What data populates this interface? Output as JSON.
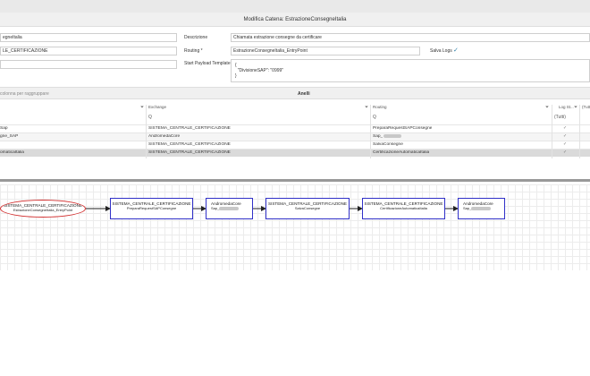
{
  "header": {
    "title": "Modifica Catena: EstrazioneConsegneItalia"
  },
  "form": {
    "name_value": "egneItalia",
    "system_value": "LE_CERTIFICAZIONE",
    "descrizione_label": "Descrizione",
    "descrizione_value": "Chiamata estrazione consegne da certificare",
    "routing_label": "Routing *",
    "routing_value": "EstrazioneConsegneItalia_EntryPoint",
    "salva_log_label": "Salva Logs",
    "payload_label": "Start Payload Template",
    "payload_value": "{\n  \"DivisioneSAP\": \"0999\"\n}"
  },
  "group": {
    "hint": "colonna per raggruppare",
    "title": "Anelli"
  },
  "grid": {
    "columns": [
      "Exchange",
      "Routing",
      "Log St...",
      "(Tutt"
    ],
    "filter_placeholder": "Q",
    "all_option": "(Tutti)",
    "rows": [
      {
        "name": "Sap",
        "exchange": "SISTEMA_CENTRALE_CERTIFICAZIONE",
        "routing": "PreparaRequestSAPConsegne",
        "log": true
      },
      {
        "name": "gne_SAP",
        "exchange": "AndromedaCore",
        "routing": "Sap_",
        "log": true
      },
      {
        "name": "",
        "exchange": "SISTEMA_CENTRALE_CERTIFICAZIONE",
        "routing": "SalvaConsegne",
        "log": true
      },
      {
        "name": "omaticaItalia",
        "exchange": "SISTEMA_CENTRALE_CERTIFICAZIONE",
        "routing": "CertificazioneAutomaticaItalia",
        "log": true
      }
    ]
  },
  "flow": {
    "nodes": [
      {
        "line1": "SISTEMA_CENTRALE_CERTIFICAZIONE",
        "line2": "EstrazioneConsegneItalia_EntryPoint",
        "type": "start"
      },
      {
        "line1": "SISTEMA_CENTRALE_CERTIFICAZIONE",
        "line2": "PreparaRequestSAPConsegne",
        "type": "step"
      },
      {
        "line1": "AndromedaCore",
        "line2": "Sap_",
        "type": "step"
      },
      {
        "line1": "SISTEMA_CENTRALE_CERTIFICAZIONE",
        "line2": "SalvaConsegne",
        "type": "step"
      },
      {
        "line1": "SISTEMA_CENTRALE_CERTIFICAZIONE",
        "line2": "CertificazioneAutomaticaItalia",
        "type": "step"
      },
      {
        "line1": "AndromedaCore",
        "line2": "Sap_",
        "type": "step"
      }
    ]
  },
  "colors": {
    "node_border": "#3030c8",
    "start_border": "#d23030",
    "check": "#2e7ea8"
  }
}
